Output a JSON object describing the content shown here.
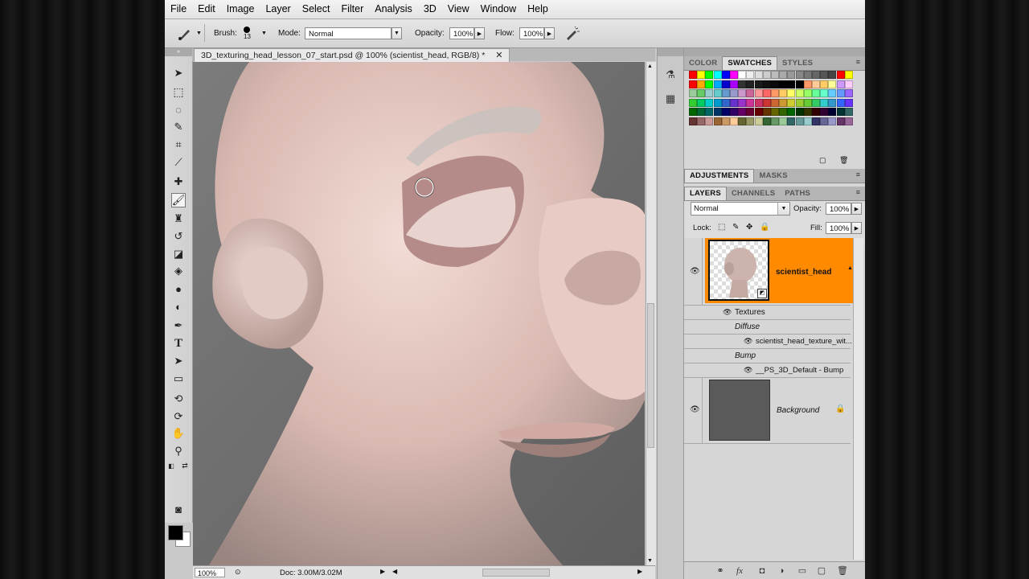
{
  "menu": [
    "File",
    "Edit",
    "Image",
    "Layer",
    "Select",
    "Filter",
    "Analysis",
    "3D",
    "View",
    "Window",
    "Help"
  ],
  "options": {
    "brush_label": "Brush:",
    "brush_size": "13",
    "mode_label": "Mode:",
    "mode_value": "Normal",
    "opacity_label": "Opacity:",
    "opacity_value": "100%",
    "flow_label": "Flow:",
    "flow_value": "100%"
  },
  "document": {
    "tab_title": "3D_texturing_head_lesson_07_start.psd @ 100% (scientist_head, RGB/8) *",
    "close_glyph": "✕"
  },
  "status": {
    "zoom": "100%",
    "doc_info": "Doc: 3.00M/3.02M"
  },
  "panels": {
    "color_tabs": [
      "COLOR",
      "SWATCHES",
      "STYLES"
    ],
    "adjustment_tabs": [
      "ADJUSTMENTS",
      "MASKS"
    ],
    "layer_tabs": [
      "LAYERS",
      "CHANNELS",
      "PATHS"
    ],
    "blend_mode": "Normal",
    "opacity_label": "Opacity:",
    "opacity_value": "100%",
    "lock_label": "Lock:",
    "fill_label": "Fill:",
    "fill_value": "100%"
  },
  "layers": {
    "head_name": "scientist_head",
    "textures_label": "Textures",
    "diffuse_label": "Diffuse",
    "diffuse_texture": "scientist_head_texture_wit...",
    "bump_label": "Bump",
    "bump_texture": "__PS_3D_Default - Bump",
    "background_name": "Background"
  },
  "colors": {
    "selected_layer": "#ff8a00",
    "foreground": "#000000",
    "background": "#ffffff"
  }
}
